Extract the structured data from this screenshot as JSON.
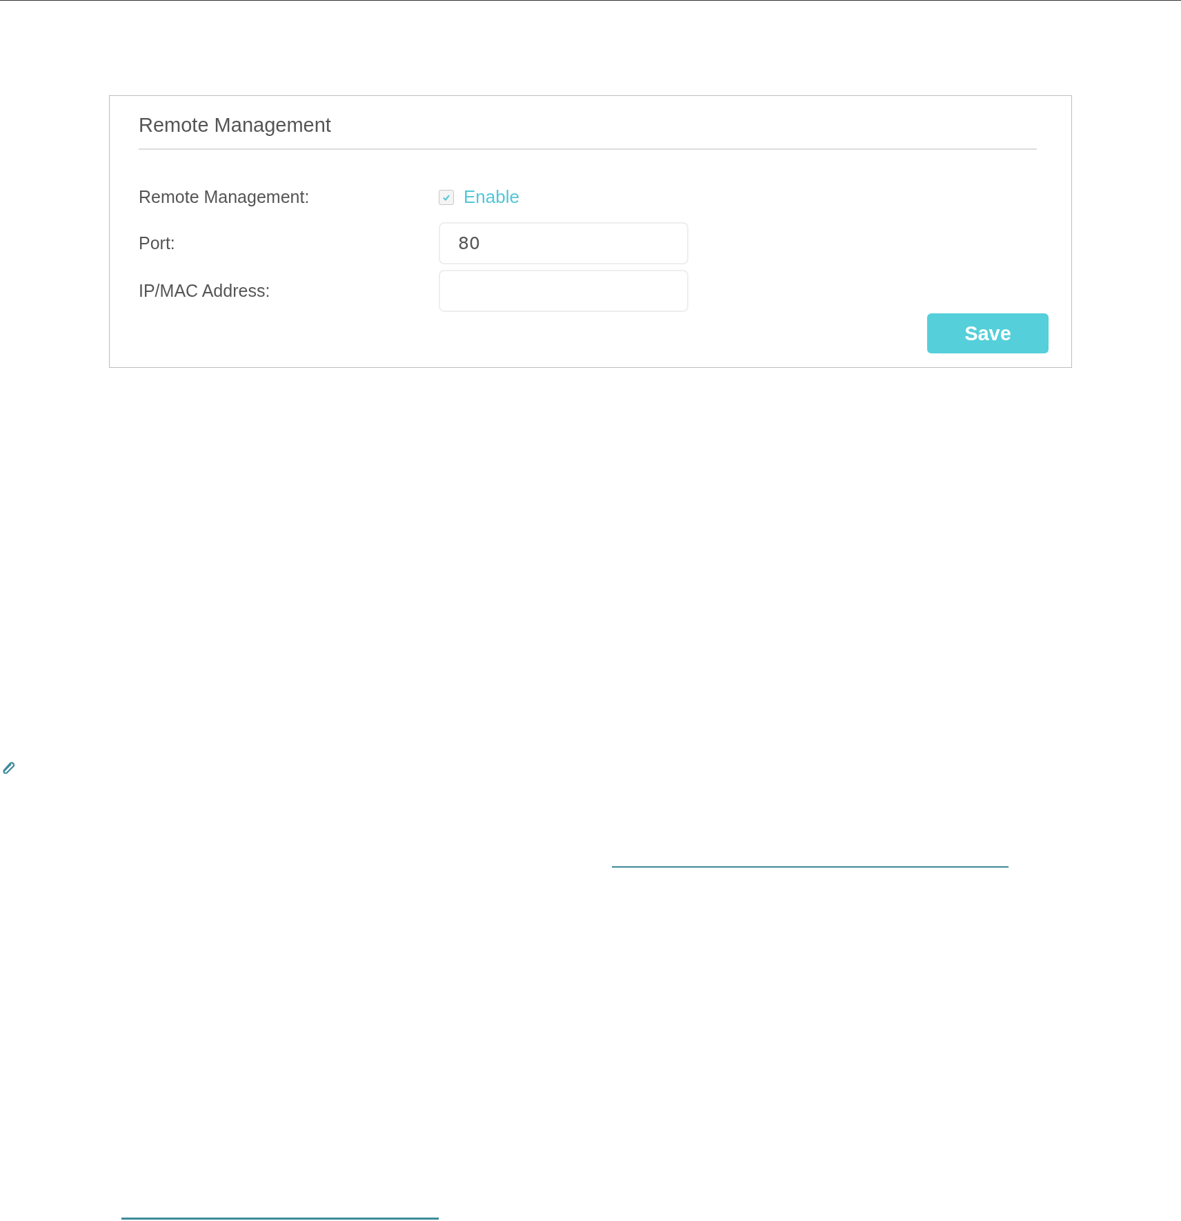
{
  "panel": {
    "title": "Remote Management",
    "fields": [
      {
        "kind": "checkbox",
        "label": "Remote Management:",
        "option": "Enable",
        "checked": true
      },
      {
        "kind": "input",
        "label": "Port:",
        "value": "80"
      },
      {
        "kind": "input",
        "label": "IP/MAC Address:"
      }
    ],
    "button": "Save"
  }
}
